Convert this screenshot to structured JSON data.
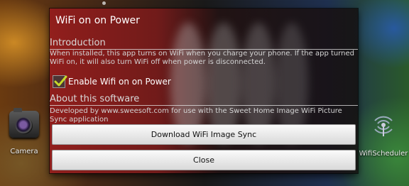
{
  "desktop": {
    "left_icon_label": "Camera",
    "right_icon_label": "WifiScheduler"
  },
  "dialog": {
    "title": "WiFi on on Power",
    "intro": {
      "heading": "Introduction",
      "text": "When installed, this app turns on WiFi when you charge your phone. If the app turned WiFi on, it will also turn WiFi off when power is disconnected."
    },
    "checkbox": {
      "label": "Enable Wifi on on Power",
      "checked": true
    },
    "about": {
      "heading": "About this software",
      "text": "Developed by www.sweesoft.com for use with the Sweet Home Image WiFi Picture Sync application"
    },
    "buttons": {
      "download": "Download WiFi Image Sync",
      "close": "Close"
    }
  },
  "colors": {
    "check_accent": "#c7d82a",
    "dialog_red": "#a01e1e"
  }
}
